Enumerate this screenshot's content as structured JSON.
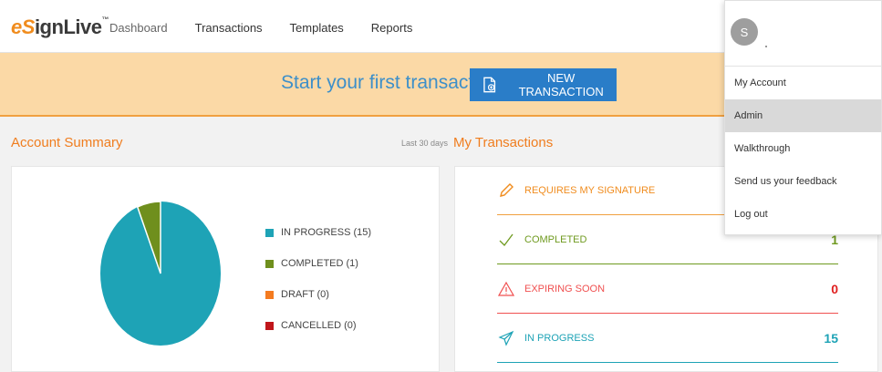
{
  "header": {
    "logo": {
      "e": "e",
      "S": "S",
      "ign": "ign",
      "Live": "Live",
      "tm": "™"
    },
    "nav": [
      "Dashboard",
      "Transactions",
      "Templates",
      "Reports"
    ]
  },
  "banner": {
    "text": "Start your first transaction",
    "button_label": "NEW TRANSACTION"
  },
  "account_summary": {
    "title": "Account Summary",
    "period": "Last 30 days",
    "legend": [
      {
        "label": "IN PROGRESS (15)",
        "color": "#1ea3b6",
        "value": 15
      },
      {
        "label": "COMPLETED (1)",
        "color": "#6f8f1d",
        "value": 1
      },
      {
        "label": "DRAFT (0)",
        "color": "#f47b20",
        "value": 0
      },
      {
        "label": "CANCELLED (0)",
        "color": "#c0161b",
        "value": 0
      }
    ]
  },
  "my_transactions": {
    "title": "My Transactions",
    "rows": [
      {
        "label": "REQUIRES MY SIGNATURE",
        "count": "",
        "color": "#f08c1e",
        "icon": "pen-icon"
      },
      {
        "label": "COMPLETED",
        "count": "1",
        "color": "#6f9a1f",
        "icon": "checkmark-icon"
      },
      {
        "label": "EXPIRING SOON",
        "count": "0",
        "color": "#f05050",
        "icon": "warning-icon"
      },
      {
        "label": "IN PROGRESS",
        "count": "15",
        "color": "#1ea3b6",
        "icon": "paper-plane-icon"
      }
    ]
  },
  "user_menu": {
    "avatar_initial": "S",
    "items": [
      "My Account",
      "Admin",
      "Walkthrough",
      "Send us your feedback",
      "Log out"
    ],
    "active_index": 1
  }
}
